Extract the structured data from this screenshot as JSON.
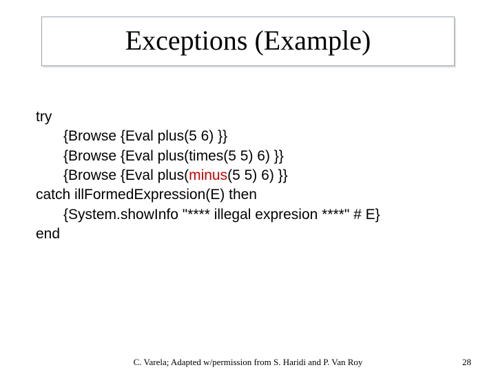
{
  "title": "Exceptions (Example)",
  "code": {
    "l0": "try",
    "l1_a": "{Browse {Eval plus(5 6) }}",
    "l2_a": "{Browse {Eval plus(times(5 5) 6) }}",
    "l3_a": "{Browse {Eval plus(",
    "l3_b": "minus",
    "l3_c": "(5 5) 6) }}",
    "l4_a": "catch",
    "l4_b": " illFormedExpression(E) ",
    "l4_c": "then",
    "l5_a": "{System.showInfo  \"**** illegal expresion ****\" # E}",
    "l6": "end"
  },
  "footer": {
    "center": "C. Varela; Adapted w/permission from S. Haridi and P. Van Roy",
    "page": "28"
  }
}
